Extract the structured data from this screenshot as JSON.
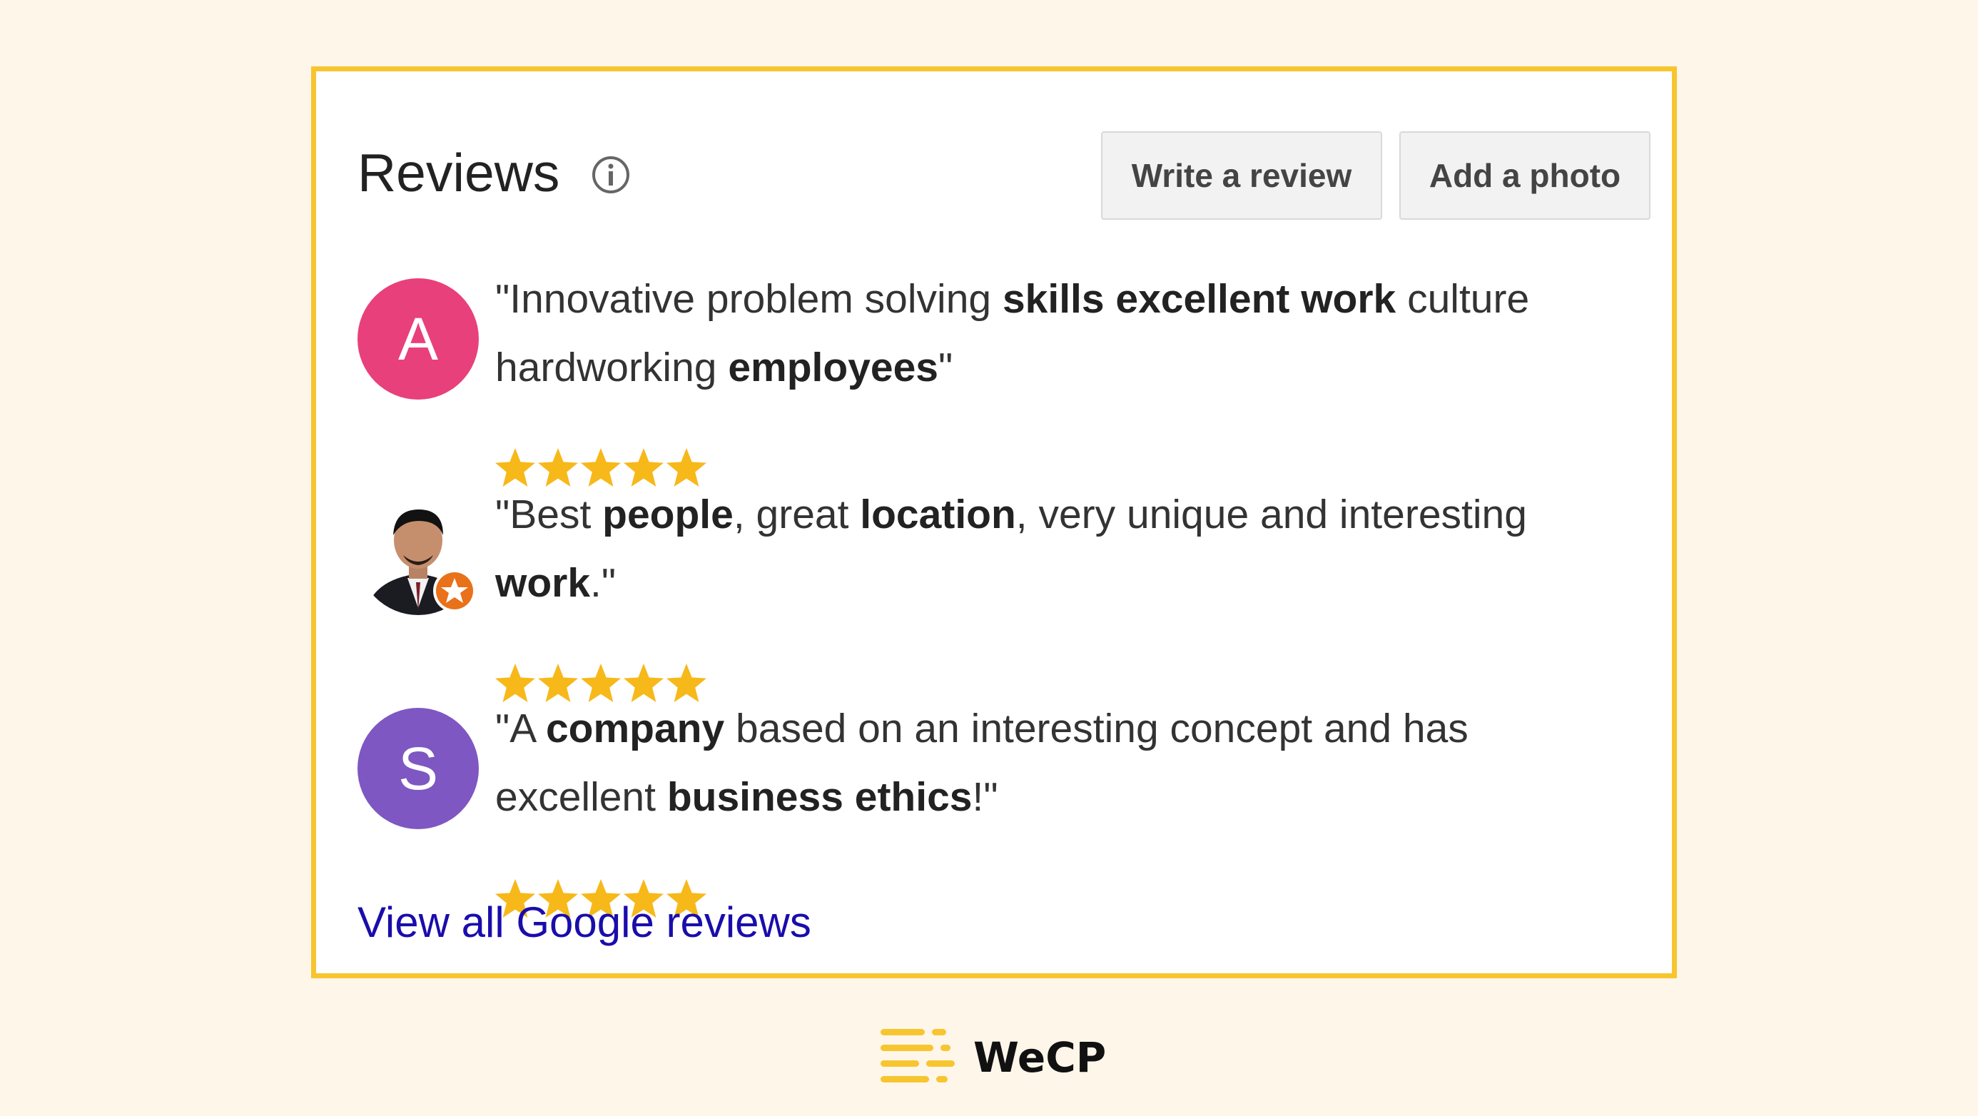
{
  "header": {
    "title": "Reviews",
    "info_icon": "info-icon",
    "write_review_label": "Write a review",
    "add_photo_label": "Add a photo"
  },
  "reviews": [
    {
      "avatar_letter": "A",
      "avatar_color": "#e8407a",
      "quote_parts": [
        {
          "text": "\"Innovative problem solving ",
          "bold": false
        },
        {
          "text": "skills excellent work",
          "bold": true
        },
        {
          "text": " culture hardworking ",
          "bold": false
        },
        {
          "text": "employees",
          "bold": true
        },
        {
          "text": "\"",
          "bold": false
        }
      ],
      "rating": 5
    },
    {
      "avatar_letter": "",
      "avatar_type": "photo",
      "badge_icon": "local-guide-star-icon",
      "quote_parts": [
        {
          "text": "\"Best ",
          "bold": false
        },
        {
          "text": "people",
          "bold": true
        },
        {
          "text": ", great ",
          "bold": false
        },
        {
          "text": "location",
          "bold": true
        },
        {
          "text": ", very unique and interesting ",
          "bold": false
        },
        {
          "text": "work",
          "bold": true
        },
        {
          "text": ".\"",
          "bold": false
        }
      ],
      "rating": 5
    },
    {
      "avatar_letter": "S",
      "avatar_color": "#7e57c2",
      "quote_parts": [
        {
          "text": "\"A ",
          "bold": false
        },
        {
          "text": "company",
          "bold": true
        },
        {
          "text": " based on an interesting concept and has excellent ",
          "bold": false
        },
        {
          "text": "business ethics",
          "bold": true
        },
        {
          "text": "!\"",
          "bold": false
        }
      ],
      "rating": 5
    }
  ],
  "footer": {
    "view_all_label": "View all Google reviews"
  },
  "brand": {
    "name": "WeCP",
    "logo_icon": "wecp-logo-icon"
  },
  "colors": {
    "page_background": "#fff6ea",
    "card_border": "#f7c52f",
    "star": "#f7b81a",
    "link": "#1a0dab",
    "badge": "#e8711a"
  }
}
